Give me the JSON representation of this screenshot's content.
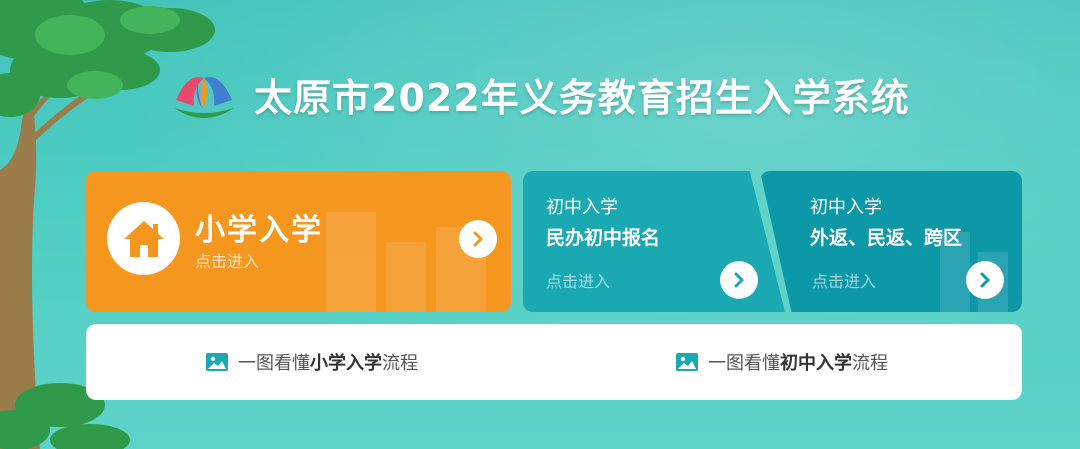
{
  "header": {
    "title": "太原市2022年义务教育招生入学系统"
  },
  "cards": {
    "primary": {
      "title": "小学入学",
      "action": "点击进入"
    },
    "junior_private": {
      "category": "初中入学",
      "name": "民办初中报名",
      "action": "点击进入"
    },
    "junior_return": {
      "category": "初中入学",
      "name": "外返、民返、跨区",
      "action": "点击进入"
    }
  },
  "flow": {
    "primary": {
      "prefix": "一图看懂",
      "highlight": "小学入学",
      "suffix": "流程"
    },
    "junior": {
      "prefix": "一图看懂",
      "highlight": "初中入学",
      "suffix": "流程"
    }
  },
  "colors": {
    "background": "#4ecdc2",
    "primary_card": "#f5961f",
    "mid_card": "#1aa8b3",
    "right_card": "#0d98a8",
    "flow_icon": "#1aa8b3"
  },
  "icons": {
    "logo": "flower-logo-icon",
    "house": "house-icon",
    "arrow": "chevron-right-icon",
    "image": "image-icon"
  }
}
